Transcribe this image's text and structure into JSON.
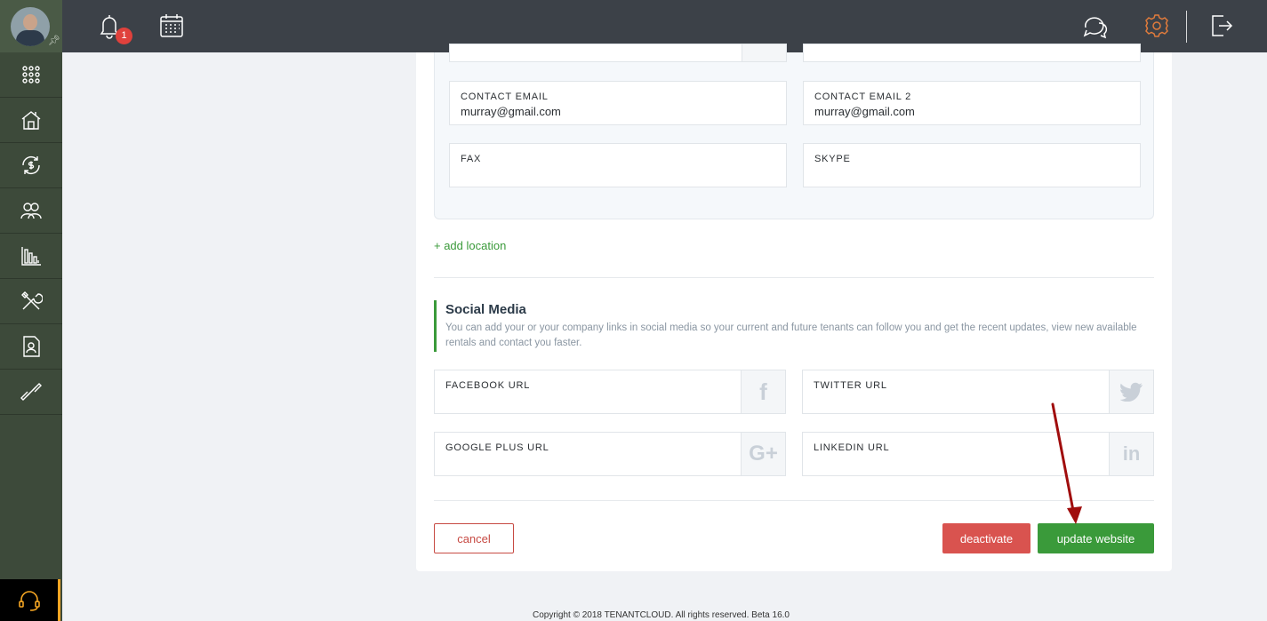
{
  "topbar": {
    "notifications_count": "1"
  },
  "location_fields": {
    "contact_email": {
      "label": "CONTACT EMAIL",
      "value": "murray@gmail.com"
    },
    "contact_email_2": {
      "label": "CONTACT EMAIL 2",
      "value": "murray@gmail.com"
    },
    "fax": {
      "label": "FAX",
      "value": ""
    },
    "skype": {
      "label": "SKYPE",
      "value": ""
    }
  },
  "add_location_label": "+ add location",
  "social_media": {
    "title": "Social Media",
    "description": "You can add your or your company links in social media so your current and future tenants can follow you and get the recent updates, view new available rentals and contact you faster.",
    "facebook": {
      "label": "FACEBOOK URL",
      "icon": "f"
    },
    "twitter": {
      "label": "TWITTER URL"
    },
    "google_plus": {
      "label": "GOOGLE PLUS URL",
      "icon": "G+"
    },
    "linkedin": {
      "label": "LINKEDIN URL",
      "icon": "in"
    }
  },
  "buttons": {
    "cancel": "cancel",
    "deactivate": "deactivate",
    "update": "update website"
  },
  "footer": "Copyright © 2018 TENANTCLOUD. All rights reserved. Beta 16.0",
  "colors": {
    "accent_green": "#3a9a3a",
    "danger_red": "#d9534f",
    "sidebar_bg": "#3d4a3a",
    "topbar_bg": "#3c4148",
    "support_orange": "#f5a623"
  }
}
